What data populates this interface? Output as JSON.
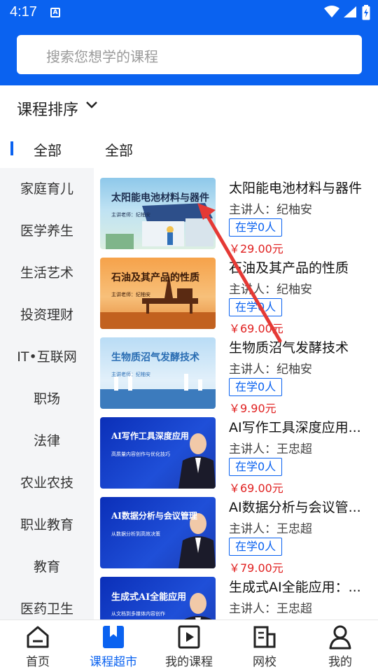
{
  "status_bar": {
    "time": "4:17",
    "notification_icon": "A"
  },
  "search": {
    "placeholder": "搜索您想学的课程"
  },
  "sort": {
    "label": "课程排序"
  },
  "category_header": {
    "left": "全部",
    "right": "全部"
  },
  "sidebar": {
    "items": [
      {
        "label": "家庭育儿"
      },
      {
        "label": "医学养生"
      },
      {
        "label": "生活艺术"
      },
      {
        "label": "投资理财"
      },
      {
        "label": "IT•互联网"
      },
      {
        "label": "职场"
      },
      {
        "label": "法律"
      },
      {
        "label": "农业农技"
      },
      {
        "label": "职业教育"
      },
      {
        "label": "教育"
      },
      {
        "label": "医药卫生"
      }
    ]
  },
  "courses": [
    {
      "title": "太阳能电池材料与器件",
      "lecturer": "主讲人：纪柚安",
      "learning": "在学0人",
      "price": "￥29.00元",
      "thumb_title": "太阳能电池材料与器件",
      "thumb_sub": "主讲老师：纪柚安"
    },
    {
      "title": "石油及其产品的性质",
      "lecturer": "主讲人：纪柚安",
      "learning": "在学0人",
      "price": "￥69.00元",
      "thumb_title": "石油及其产品的性质",
      "thumb_sub": "主讲老师：纪柚安"
    },
    {
      "title": "生物质沼气发酵技术",
      "lecturer": "主讲人：纪柚安",
      "learning": "在学0人",
      "price": "￥9.90元",
      "thumb_title": "生物质沼气发酵技术",
      "thumb_sub": "主讲老师：纪柚安"
    },
    {
      "title": "AI写作工具深度应用...",
      "lecturer": "主讲人：王忠超",
      "learning": "在学0人",
      "price": "￥69.00元",
      "thumb_title": "AI写作工具深度应用",
      "thumb_sub": "高质量内容创作与优化技巧"
    },
    {
      "title": "AI数据分析与会议管...",
      "lecturer": "主讲人：王忠超",
      "learning": "在学0人",
      "price": "￥79.00元",
      "thumb_title": "AI数据分析与会议管理",
      "thumb_sub": "从数据分析到高效决策"
    },
    {
      "title": "生成式AI全能应用：...",
      "lecturer": "主讲人：王忠超",
      "learning": "",
      "price": "",
      "thumb_title": "生成式AI全能应用",
      "thumb_sub": "从文档到多媒体内容创作"
    }
  ],
  "bottom_nav": {
    "items": [
      {
        "label": "首页",
        "icon": "home-icon"
      },
      {
        "label": "课程超市",
        "icon": "bookmark-icon"
      },
      {
        "label": "我的课程",
        "icon": "play-book-icon"
      },
      {
        "label": "网校",
        "icon": "school-icon"
      },
      {
        "label": "我的",
        "icon": "person-icon"
      }
    ],
    "active_index": 1
  },
  "colors": {
    "brand": "#0a62f0",
    "price": "#e02020",
    "annotation_arrow": "#e53935"
  }
}
